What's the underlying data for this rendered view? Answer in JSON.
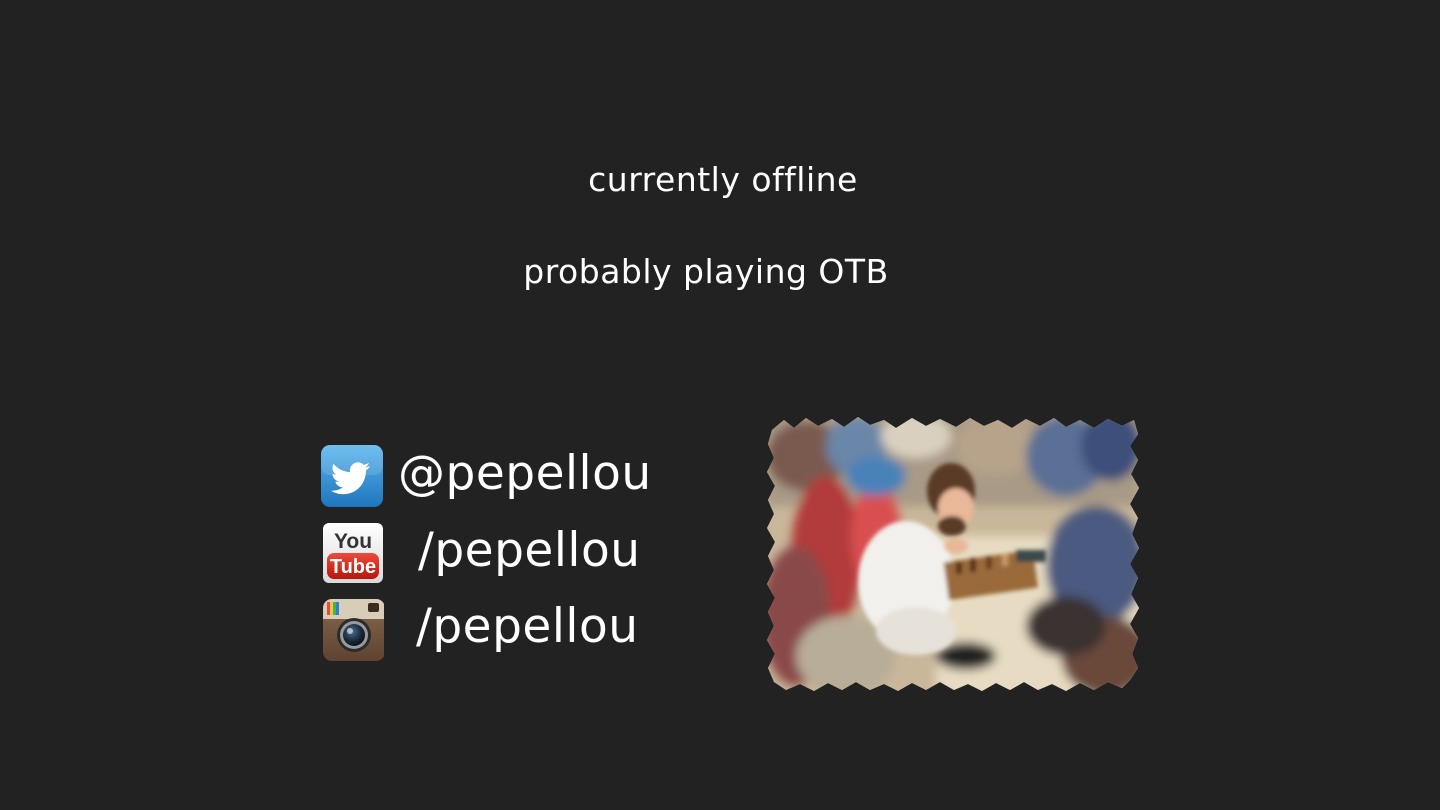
{
  "status": {
    "line1": "currently offline",
    "line2": "probably playing OTB"
  },
  "socials": [
    {
      "platform": "twitter",
      "icon": "twitter-bird-icon",
      "handle": "@pepellou",
      "color": "#2a8ad4"
    },
    {
      "platform": "youtube",
      "icon": "youtube-logo-icon",
      "handle": "/pepellou",
      "color": "#d52b1e"
    },
    {
      "platform": "instagram",
      "icon": "instagram-camera-icon",
      "handle": "/pepellou",
      "color": "#7a5a43"
    }
  ],
  "youtube_logo_text": {
    "top": "You",
    "bottom": "Tube"
  },
  "colors": {
    "background": "#222222",
    "text": "#ffffff"
  }
}
